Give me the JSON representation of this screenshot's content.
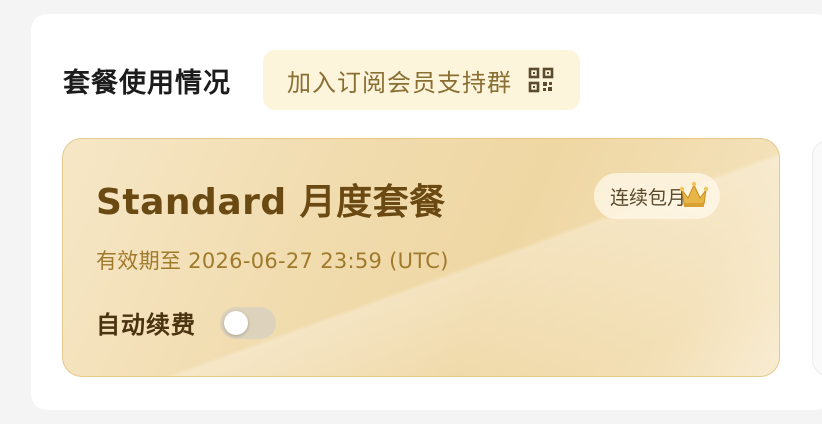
{
  "section": {
    "title": "套餐使用情况",
    "join_group_label": "加入订阅会员支持群",
    "join_group_icon": "qr-code-icon"
  },
  "plan": {
    "name": "Standard 月度套餐",
    "expiry_text": "有效期至 2026-06-27 23:59 (UTC)",
    "badge_label": "连续包月",
    "badge_icon": "crown-icon",
    "auto_renew_label": "自动续费",
    "auto_renew_enabled": false
  },
  "colors": {
    "card_gold": "#f1dcaf",
    "title_brown": "#6a4a12",
    "expiry_gold": "#a07a2c",
    "join_bg": "#fdf4dc"
  }
}
